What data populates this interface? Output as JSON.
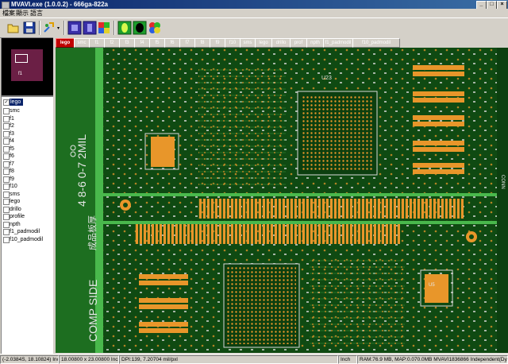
{
  "window": {
    "title": "MVAVI.exe (1.0.0.2) - 666ga-822a",
    "minimize": "_",
    "maximize": "□",
    "close": "×"
  },
  "menu": [
    "檔案",
    "顯示",
    "語言"
  ],
  "toolbar": [
    "open-icon",
    "save-icon",
    "pick-icon",
    "layer-blue-icon",
    "layer-blue-2-icon",
    "layer-color-icon",
    "layer-green-icon",
    "layer-black-icon",
    "color-picker-icon"
  ],
  "thumbnail": {
    "label": "f1"
  },
  "layers": [
    {
      "name": "lego",
      "checked": true,
      "selected": true
    },
    {
      "name": "smc",
      "checked": false
    },
    {
      "name": "f1",
      "checked": false
    },
    {
      "name": "f2",
      "checked": false
    },
    {
      "name": "f3",
      "checked": false
    },
    {
      "name": "f4",
      "checked": false
    },
    {
      "name": "f5",
      "checked": false
    },
    {
      "name": "f6",
      "checked": false
    },
    {
      "name": "f7",
      "checked": false
    },
    {
      "name": "f8",
      "checked": false
    },
    {
      "name": "f9",
      "checked": false
    },
    {
      "name": "f10",
      "checked": false
    },
    {
      "name": "sms",
      "checked": false
    },
    {
      "name": "lego",
      "checked": false
    },
    {
      "name": "drillo",
      "checked": false
    },
    {
      "name": "profile",
      "checked": false
    },
    {
      "name": "npth",
      "checked": false
    },
    {
      "name": "f1_padmodil",
      "checked": false
    },
    {
      "name": "f10_padmodil",
      "checked": false
    }
  ],
  "tabs": [
    "lego",
    "smc",
    "f1",
    "f2",
    "f3",
    "f4",
    "f5",
    "f6",
    "f7",
    "f8",
    "f9",
    "f10",
    "sms",
    "lego",
    "drillo",
    "prof",
    "npth",
    "f1_padmodil",
    "f10_padmodil"
  ],
  "board_text": [
    "COMP SIDE",
    "4 8-6 0-7 2MIL",
    "成品板厚",
    "U23",
    "CONN",
    "COMP SIDE",
    "U5"
  ],
  "colors": {
    "board": "#0f4a12",
    "copper": "#e8962a",
    "silk": "#e6e6e6",
    "fill": "#1a6b1c",
    "edge": "#49b84c",
    "accent": "#c00000"
  },
  "status": [
    "(-2.0384S, 18.10824) Inch",
    "18.00800 x 23.00800 Inch",
    "DPI:139, 7.20704 mil/pxl",
    "Inch",
    "RAM:76.9 MB, MAP:0.070.0MB MVAVI1836866 Independent(Dyn)"
  ]
}
